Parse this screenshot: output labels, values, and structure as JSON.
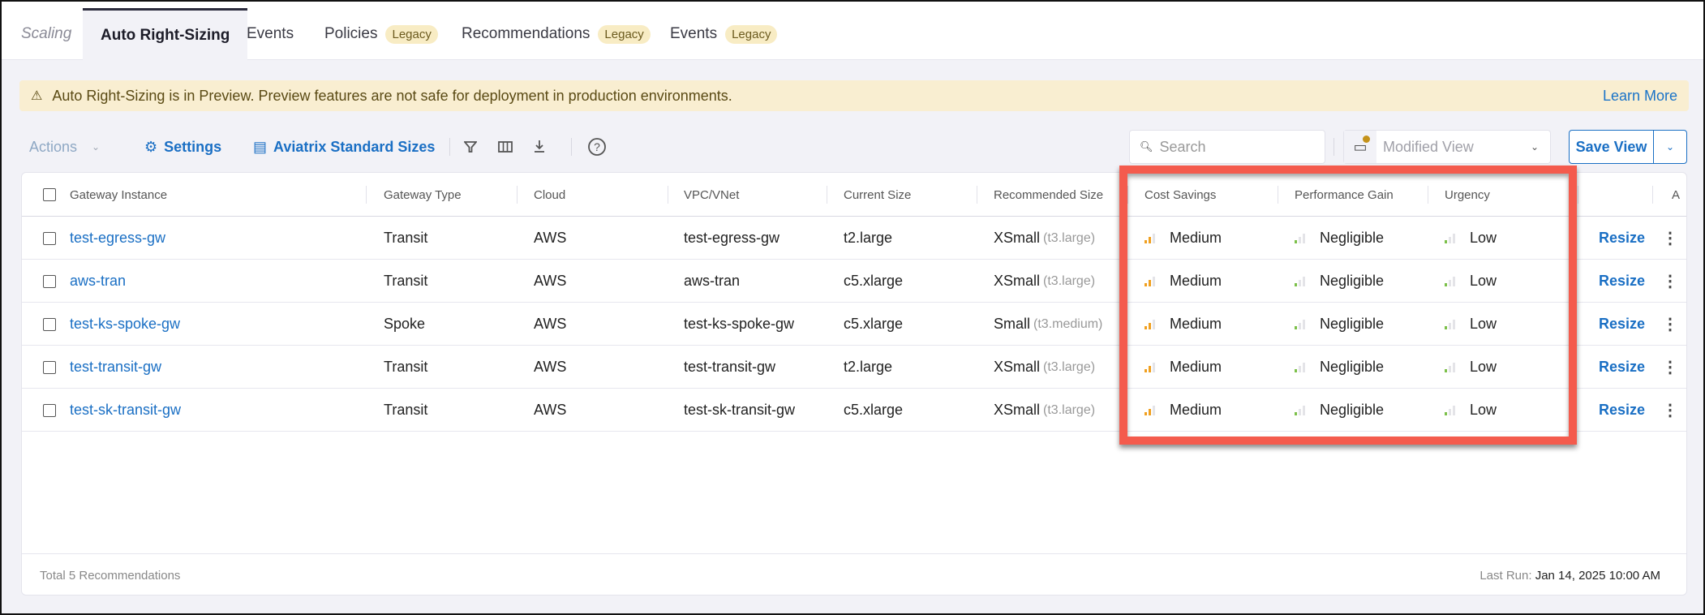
{
  "tabs": [
    {
      "label": "Scaling",
      "legacy": false
    },
    {
      "label": "Auto Right-Sizing",
      "legacy": false,
      "active": true
    },
    {
      "label": "Events",
      "legacy": false
    },
    {
      "label": "Policies",
      "legacy": true
    },
    {
      "label": "Recommendations",
      "legacy": true
    },
    {
      "label": "Events",
      "legacy": true
    }
  ],
  "legacy_badge": "Legacy",
  "banner": {
    "icon": "warning-icon",
    "text": "Auto Right-Sizing is in Preview. Preview features are not safe for deployment in production environments.",
    "link": "Learn More"
  },
  "toolbar": {
    "actions_label": "Actions",
    "settings_label": "Settings",
    "standard_sizes_label": "Aviatrix Standard Sizes",
    "search_placeholder": "Search",
    "view_label": "Modified View",
    "save_view_label": "Save View"
  },
  "table": {
    "columns": [
      "Gateway Instance",
      "Gateway Type",
      "Cloud",
      "VPC/VNet",
      "Current Size",
      "Recommended Size",
      "Cost Savings",
      "Performance Gain",
      "Urgency",
      "",
      "A"
    ],
    "rows": [
      {
        "gateway": "test-egress-gw",
        "type": "Transit",
        "cloud": "AWS",
        "vpc": "test-egress-gw",
        "current": "t2.large",
        "recommended": "XSmall",
        "recommended_instance": "(t3.large)",
        "cost_savings": "Medium",
        "performance_gain": "Negligible",
        "urgency": "Low",
        "action": "Resize"
      },
      {
        "gateway": "aws-tran",
        "type": "Transit",
        "cloud": "AWS",
        "vpc": "aws-tran",
        "current": "c5.xlarge",
        "recommended": "XSmall",
        "recommended_instance": "(t3.large)",
        "cost_savings": "Medium",
        "performance_gain": "Negligible",
        "urgency": "Low",
        "action": "Resize"
      },
      {
        "gateway": "test-ks-spoke-gw",
        "type": "Spoke",
        "cloud": "AWS",
        "vpc": "test-ks-spoke-gw",
        "current": "c5.xlarge",
        "recommended": "Small",
        "recommended_instance": "(t3.medium)",
        "cost_savings": "Medium",
        "performance_gain": "Negligible",
        "urgency": "Low",
        "action": "Resize"
      },
      {
        "gateway": "test-transit-gw",
        "type": "Transit",
        "cloud": "AWS",
        "vpc": "test-transit-gw",
        "current": "t2.large",
        "recommended": "XSmall",
        "recommended_instance": "(t3.large)",
        "cost_savings": "Medium",
        "performance_gain": "Negligible",
        "urgency": "Low",
        "action": "Resize"
      },
      {
        "gateway": "test-sk-transit-gw",
        "type": "Transit",
        "cloud": "AWS",
        "vpc": "test-sk-transit-gw",
        "current": "c5.xlarge",
        "recommended": "XSmall",
        "recommended_instance": "(t3.large)",
        "cost_savings": "Medium",
        "performance_gain": "Negligible",
        "urgency": "Low",
        "action": "Resize"
      }
    ]
  },
  "levels": {
    "Medium": {
      "bars_filled": 2,
      "color": "#f0a020"
    },
    "Negligible": {
      "bars_filled": 1,
      "color": "#7cc04a"
    },
    "Low": {
      "bars_filled": 1,
      "color": "#7cc04a"
    }
  },
  "footer": {
    "total": "Total 5 Recommendations",
    "last_run_label": "Last Run:",
    "last_run_value": "Jan 14, 2025 10:00 AM"
  },
  "colors": {
    "accent": "#1a6fc4",
    "highlight": "#f45b4d",
    "banner_bg": "#f9eed1",
    "badge_bg": "#f8ecc4"
  }
}
